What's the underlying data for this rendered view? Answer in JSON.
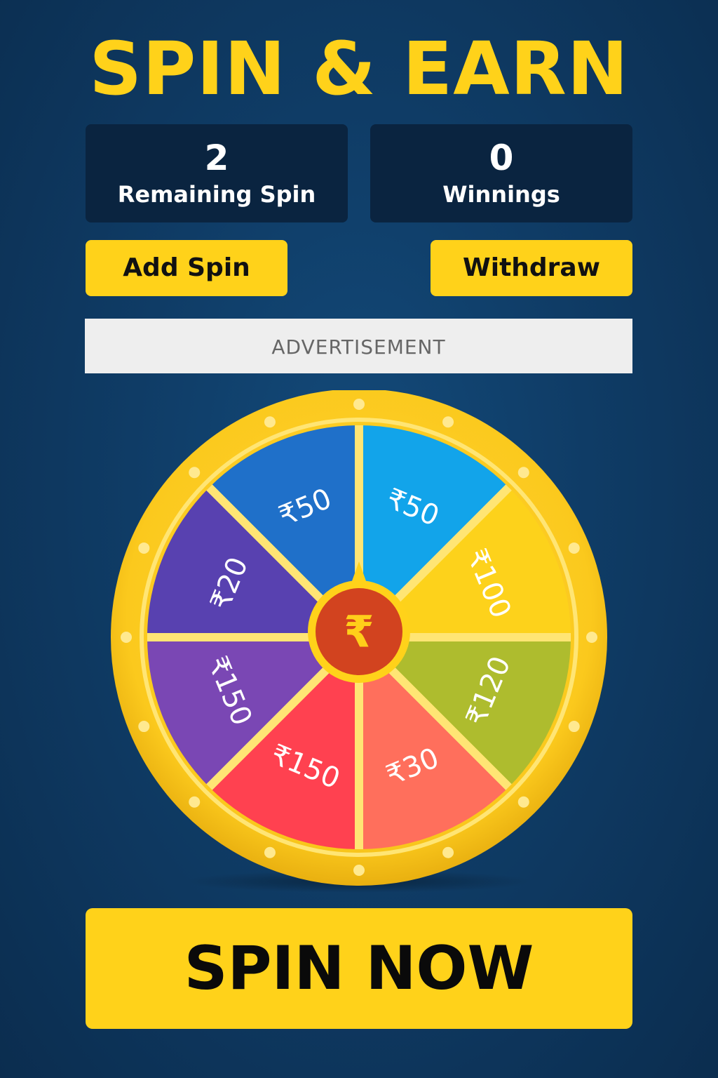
{
  "title": "SPIN & EARN",
  "stats": {
    "remaining": {
      "value": "2",
      "label": "Remaining Spin"
    },
    "winnings": {
      "value": "0",
      "label": "Winnings"
    }
  },
  "buttons": {
    "add_spin": "Add Spin",
    "withdraw": "Withdraw",
    "spin_now": "SPIN NOW"
  },
  "advertisement": "ADVERTISEMENT",
  "wheel": {
    "center_symbol": "₹",
    "segments": [
      {
        "label": "₹50",
        "color": "#12a4ea"
      },
      {
        "label": "₹100",
        "color": "#fdd21b"
      },
      {
        "label": "₹120",
        "color": "#aebc2e"
      },
      {
        "label": "₹30",
        "color": "#ff6f5c"
      },
      {
        "label": "₹150",
        "color": "#ff4150"
      },
      {
        "label": "₹150",
        "color": "#7a47b4"
      },
      {
        "label": "₹20",
        "color": "#5841b0"
      },
      {
        "label": "₹50",
        "color": "#1f70c9"
      }
    ],
    "colors": {
      "rim": "#fbc91d",
      "rim_light": "#ffe16a",
      "hub": "#d2431f",
      "hub_ring": "#ffd21a",
      "hub_symbol": "#ffcf1a"
    }
  },
  "colors": {
    "accent": "#ffd21a",
    "background": "#0f3c66",
    "card": "#0a2440"
  }
}
